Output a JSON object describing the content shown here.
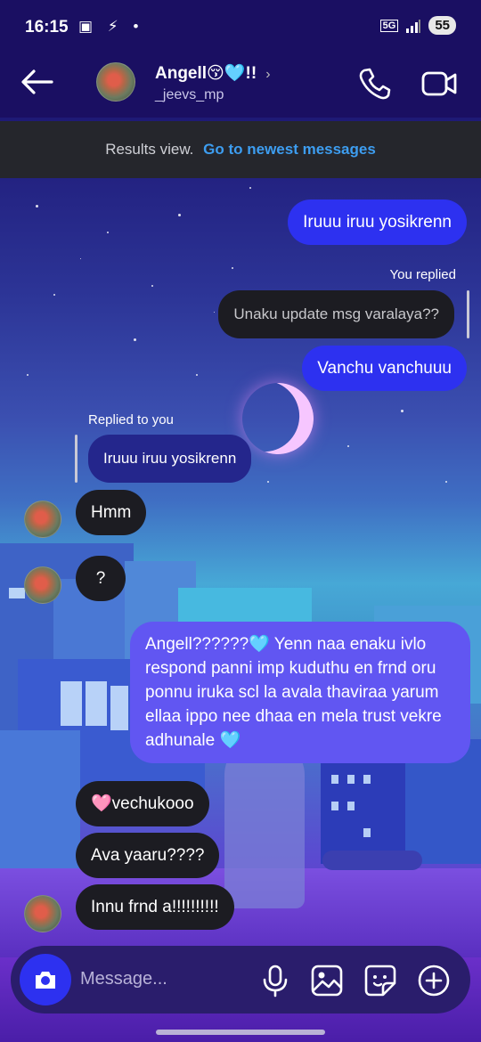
{
  "status_bar": {
    "time": "16:15",
    "left_icons": "▣ ⚡ •",
    "network": "5G",
    "battery": "55"
  },
  "header": {
    "contact_name": "Angell😚🩵!!",
    "username": "_jeevs_mp",
    "chevron": "›"
  },
  "banner": {
    "text": "Results view.",
    "link": "Go to newest messages"
  },
  "messages": [
    {
      "side": "out",
      "text": "Iruuu iruu yosikrenn"
    },
    {
      "side": "out",
      "label": "You replied",
      "quote": "Unaku update msg varalaya??"
    },
    {
      "side": "out",
      "text": "Vanchu vanchuuu"
    },
    {
      "side": "in",
      "label": "Replied to you",
      "quote": "Iruuu iruu yosikrenn"
    },
    {
      "side": "in",
      "text": "Hmm"
    },
    {
      "side": "in",
      "text": "?"
    },
    {
      "side": "out",
      "text": "Angell??????🩵 Yenn naa enaku ivlo respond panni imp kuduthu en frnd oru ponnu iruka scl la avala thaviraa yarum ellaa ippo nee dhaa en mela trust vekre adhunale 🩵"
    },
    {
      "side": "in",
      "text": "🩷vechukooo"
    },
    {
      "side": "in",
      "text": "Ava yaaru????"
    },
    {
      "side": "in",
      "text": "Innu frnd a!!!!!!!!!!"
    }
  ],
  "composer": {
    "placeholder": "Message..."
  },
  "colors": {
    "outgoing_bubble": "#2d31f0",
    "outgoing_bubble_alt": "#6156f2",
    "incoming_bubble": "#1c1c22",
    "link": "#3d9df0"
  },
  "icons": [
    "back-arrow-icon",
    "phone-icon",
    "video-camera-icon",
    "camera-icon",
    "microphone-icon",
    "gallery-icon",
    "sticker-icon",
    "plus-icon"
  ]
}
